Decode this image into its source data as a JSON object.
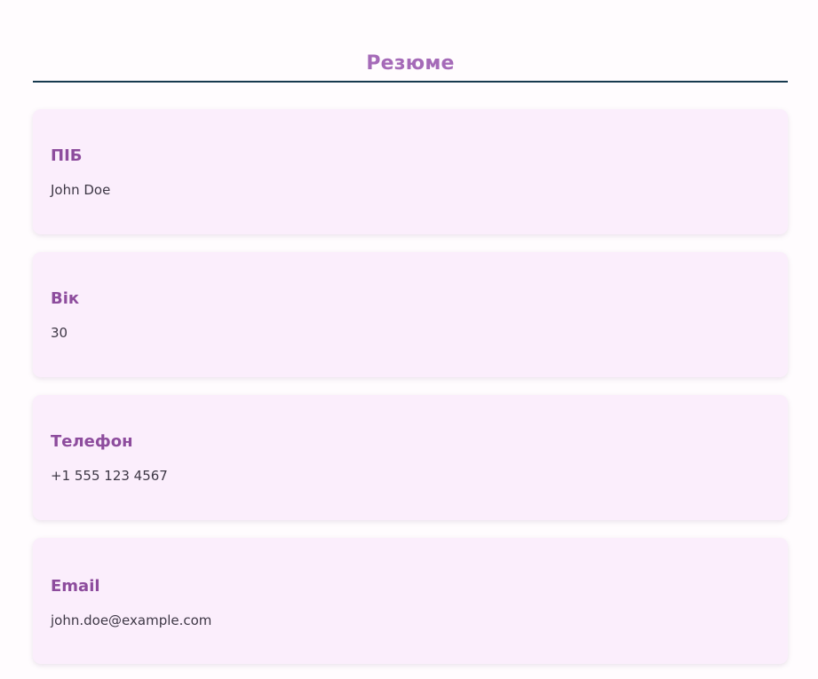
{
  "header": {
    "title": "Резюме"
  },
  "cards": [
    {
      "label": "ПІБ",
      "value": "John Doe"
    },
    {
      "label": "Вік",
      "value": "30"
    },
    {
      "label": "Телефон",
      "value": "+1 555 123 4567"
    },
    {
      "label": "Email",
      "value": "john.doe@example.com"
    }
  ],
  "colors": {
    "title": "#a56ab8",
    "label": "#8d4c9d",
    "rule": "#173a4f",
    "card_background": "#fbeefc",
    "page_background": "#fffcfe"
  }
}
